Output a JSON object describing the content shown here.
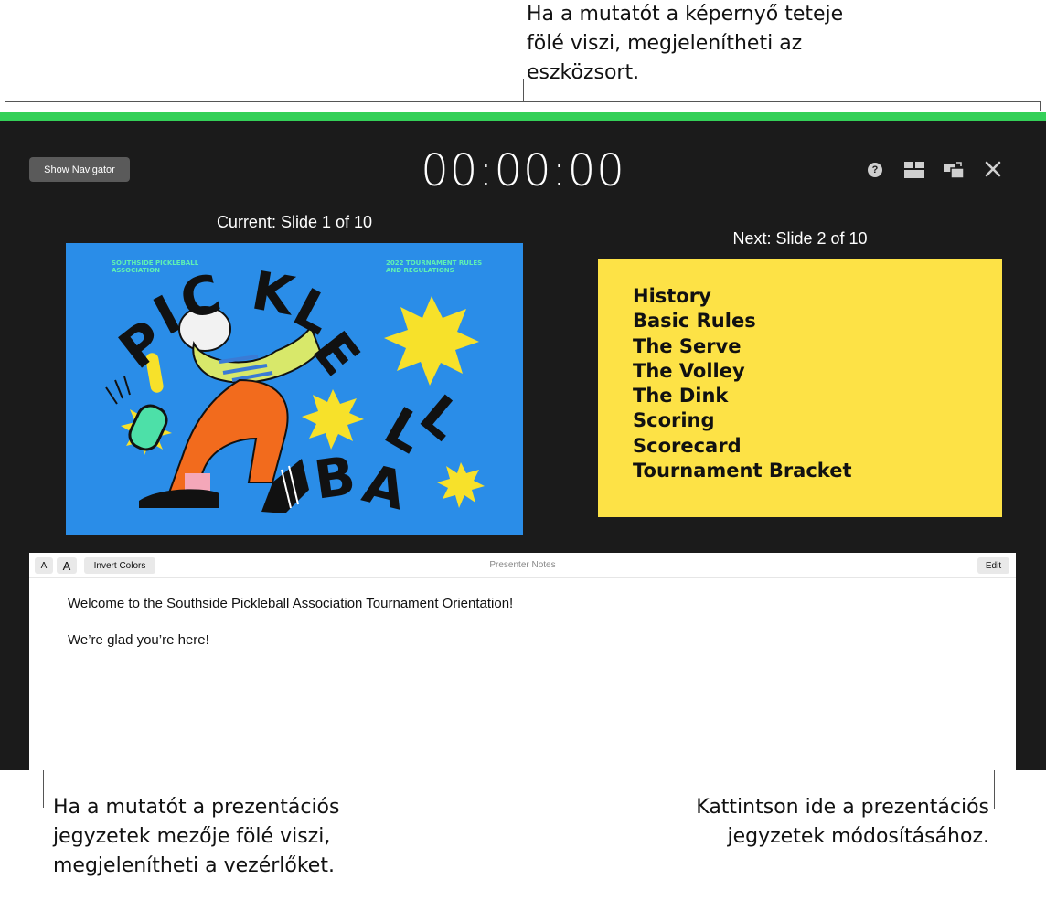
{
  "callouts": {
    "top": "Ha a mutatót a képernyő teteje fölé viszi, megjelenítheti az eszközsort.",
    "left": "Ha a mutatót a prezentációs jegyzetek mezője fölé viszi, megjelenítheti a vezérlőket.",
    "right": "Kattintson ide a prezentációs jegyzetek módosításához."
  },
  "toolbar": {
    "navigator_label": "Show Navigator",
    "timer": "00:00:00",
    "help_glyph": "?"
  },
  "icons": {
    "help": "help-icon",
    "layout": "layout-icon",
    "swap": "swap-displays-icon",
    "close": "close-icon"
  },
  "current": {
    "label": "Current: Slide 1 of 10",
    "org": "SOUTHSIDE PICKLEBALL ASSOCIATION",
    "event": "2022 TOURNAMENT RULES AND REGULATIONS",
    "word1": "PICKLE",
    "word2": "BALL"
  },
  "next": {
    "label": "Next: Slide 2 of 10",
    "items": [
      "History",
      "Basic Rules",
      "The Serve",
      "The Volley",
      "The Dink",
      "Scoring",
      "Scorecard",
      "Tournament Bracket"
    ]
  },
  "notes": {
    "font_small": "A",
    "font_large": "A",
    "invert_label": "Invert Colors",
    "title": "Presenter Notes",
    "edit_label": "Edit",
    "lines": [
      "Welcome to the Southside Pickleball Association Tournament Orientation!",
      "We’re glad you’re here!"
    ]
  },
  "colors": {
    "accent_green": "#34d058",
    "window_bg": "#1b1b1b",
    "slide_blue": "#2a8de8",
    "slide_yellow": "#fde246"
  }
}
